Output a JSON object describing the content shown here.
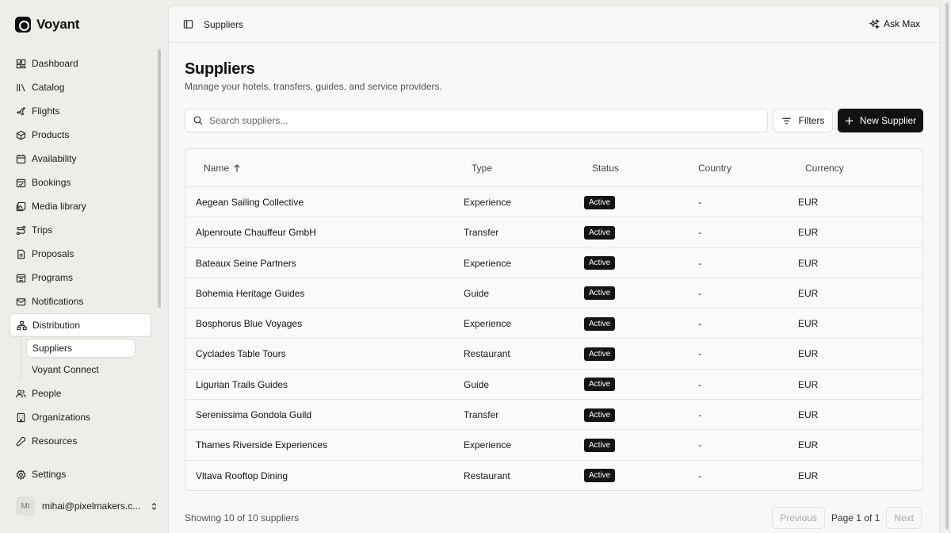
{
  "brand": {
    "name": "Voyant"
  },
  "nav": {
    "items": [
      {
        "label": "Dashboard",
        "icon": "dashboard-icon"
      },
      {
        "label": "Catalog",
        "icon": "catalog-icon"
      },
      {
        "label": "Flights",
        "icon": "plane-icon"
      },
      {
        "label": "Products",
        "icon": "box-icon"
      },
      {
        "label": "Availability",
        "icon": "calendar-icon"
      },
      {
        "label": "Bookings",
        "icon": "calendar-check-icon"
      },
      {
        "label": "Media library",
        "icon": "image-icon"
      },
      {
        "label": "Trips",
        "icon": "route-icon"
      },
      {
        "label": "Proposals",
        "icon": "document-icon"
      },
      {
        "label": "Programs",
        "icon": "calendar-grid-icon"
      },
      {
        "label": "Notifications",
        "icon": "mail-icon"
      },
      {
        "label": "Distribution",
        "icon": "network-icon"
      }
    ],
    "sub_items": [
      {
        "label": "Suppliers"
      },
      {
        "label": "Voyant Connect"
      }
    ],
    "after": [
      {
        "label": "People",
        "icon": "users-icon"
      },
      {
        "label": "Organizations",
        "icon": "building-icon"
      },
      {
        "label": "Resources",
        "icon": "wrench-icon"
      }
    ],
    "settings_label": "Settings"
  },
  "user": {
    "initials": "MI",
    "email": "mihai@pixelmakers.c..."
  },
  "topbar": {
    "breadcrumb": "Suppliers",
    "ask_label": "Ask Max"
  },
  "page": {
    "title": "Suppliers",
    "subtitle": "Manage your hotels, transfers, guides, and service providers."
  },
  "search": {
    "placeholder": "Search suppliers..."
  },
  "toolbar": {
    "filters_label": "Filters",
    "new_label": "New Supplier"
  },
  "table": {
    "columns": [
      "Name",
      "Type",
      "Status",
      "Country",
      "Currency"
    ],
    "rows": [
      {
        "name": "Aegean Sailing Collective",
        "type": "Experience",
        "status": "Active",
        "country": "-",
        "currency": "EUR"
      },
      {
        "name": "Alpenroute Chauffeur GmbH",
        "type": "Transfer",
        "status": "Active",
        "country": "-",
        "currency": "EUR"
      },
      {
        "name": "Bateaux Seine Partners",
        "type": "Experience",
        "status": "Active",
        "country": "-",
        "currency": "EUR"
      },
      {
        "name": "Bohemia Heritage Guides",
        "type": "Guide",
        "status": "Active",
        "country": "-",
        "currency": "EUR"
      },
      {
        "name": "Bosphorus Blue Voyages",
        "type": "Experience",
        "status": "Active",
        "country": "-",
        "currency": "EUR"
      },
      {
        "name": "Cyclades Table Tours",
        "type": "Restaurant",
        "status": "Active",
        "country": "-",
        "currency": "EUR"
      },
      {
        "name": "Ligurian Trails Guides",
        "type": "Guide",
        "status": "Active",
        "country": "-",
        "currency": "EUR"
      },
      {
        "name": "Serenissima Gondola Guild",
        "type": "Transfer",
        "status": "Active",
        "country": "-",
        "currency": "EUR"
      },
      {
        "name": "Thames Riverside Experiences",
        "type": "Experience",
        "status": "Active",
        "country": "-",
        "currency": "EUR"
      },
      {
        "name": "Vltava Rooftop Dining",
        "type": "Restaurant",
        "status": "Active",
        "country": "-",
        "currency": "EUR"
      }
    ]
  },
  "footer": {
    "showing": "Showing 10 of 10 suppliers",
    "previous": "Previous",
    "page_info": "Page 1 of 1",
    "next": "Next"
  }
}
